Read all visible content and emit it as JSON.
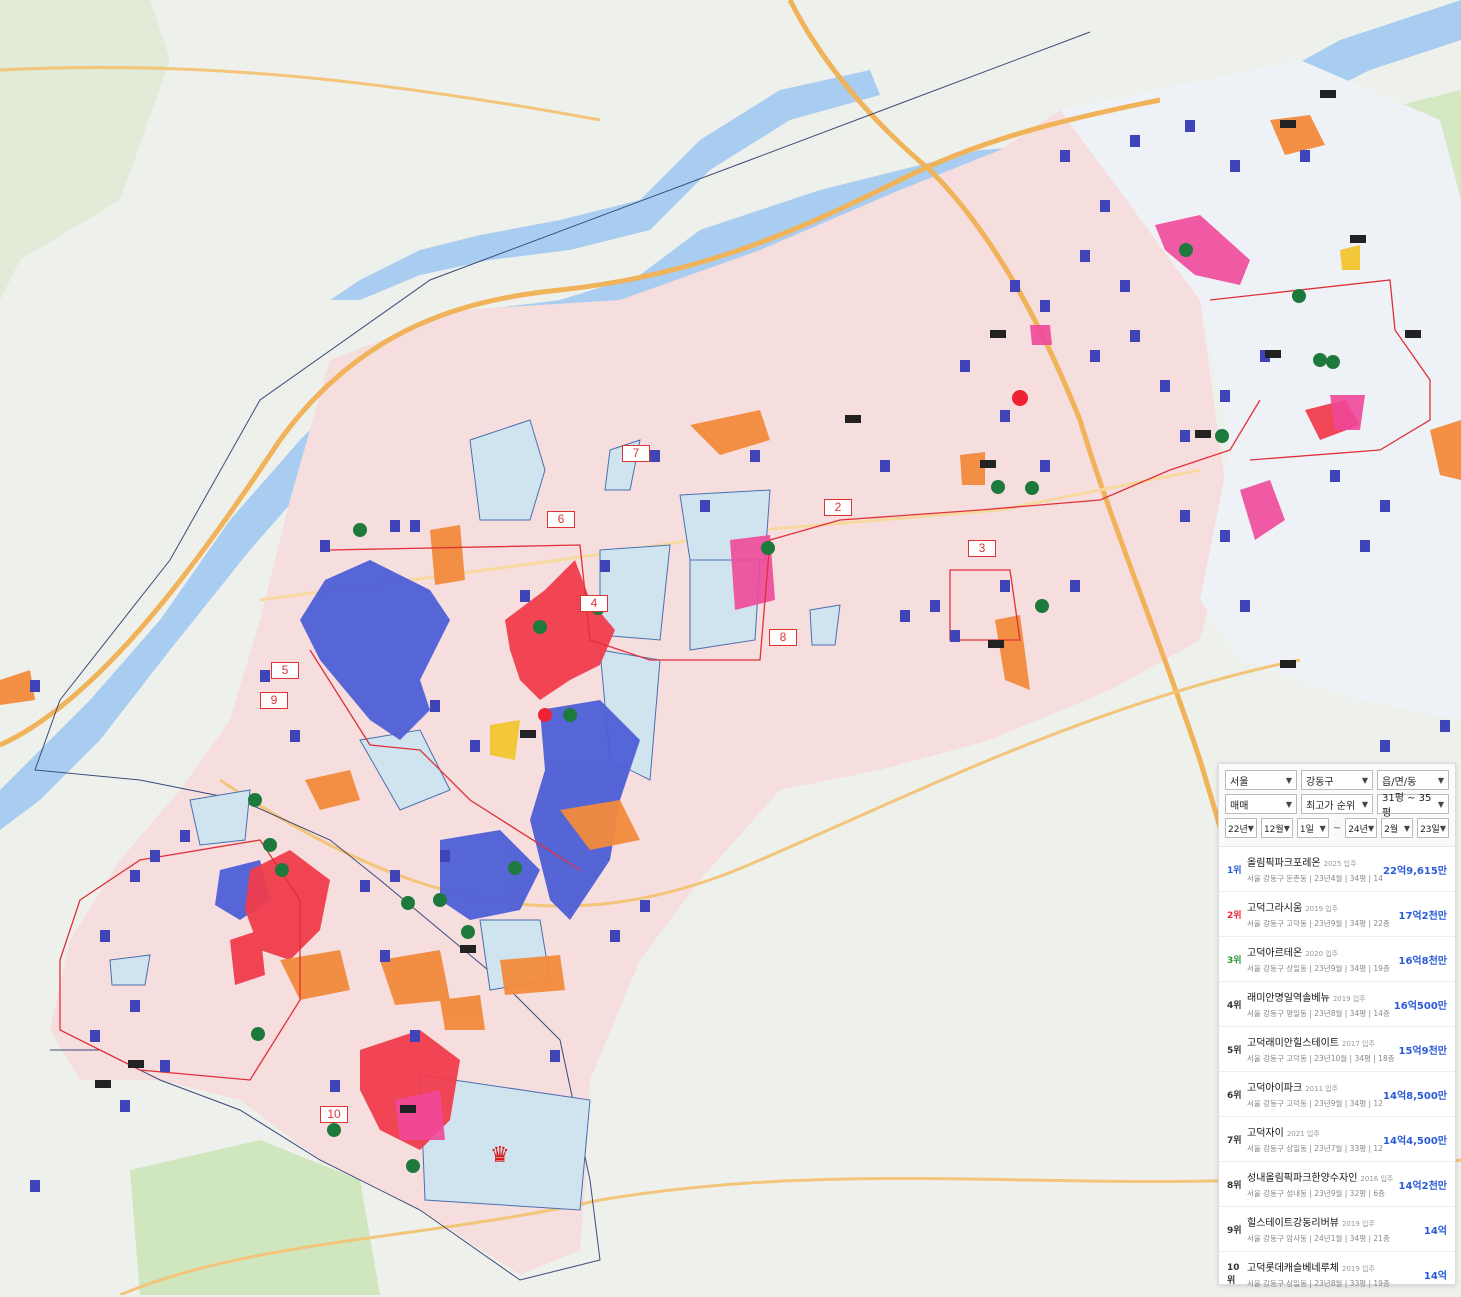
{
  "colors": {
    "water": "#a9cdf0",
    "land": "#eef0ec",
    "district_fill": "#f6dede",
    "park": "#cfe6bf",
    "road": "#f2c57a",
    "highway": "#f0b35a",
    "zone_line": "#e0303a",
    "boundary": "#3c4a7a",
    "blue_area": "#4d5fd6",
    "red_area": "#f03c4c",
    "orange_area": "#f28a3c",
    "pink_area": "#f0489a",
    "lightblue_area": "#cfe4ef",
    "accent": "#2a5bd7"
  },
  "zones": [
    "2",
    "3",
    "4",
    "5",
    "6",
    "7",
    "8",
    "9",
    "10"
  ],
  "filters": {
    "city": "서울",
    "district": "강동구",
    "dong": "읍/면/동",
    "trade": "매매",
    "sort": "최고가 순위",
    "size": "31평 ~ 35평",
    "from_year": "22년",
    "from_month": "12월",
    "from_day": "1일",
    "tilde": "~",
    "to_year": "24년",
    "to_month": "2월",
    "to_day": "23일"
  },
  "ranking": [
    {
      "rank": "1위",
      "name": "올림픽파크포레온",
      "year": "2025 입주",
      "meta": "서울 강동구 둔촌동 | 23년4월 | 34평 | 14층",
      "price": "22억9,615만"
    },
    {
      "rank": "2위",
      "name": "고덕그라시움",
      "year": "2019 입주",
      "meta": "서울 강동구 고덕동 | 23년9월 | 34평 | 22층",
      "price": "17억2천만"
    },
    {
      "rank": "3위",
      "name": "고덕아르테온",
      "year": "2020 입주",
      "meta": "서울 강동구 상일동 | 23년9월 | 34평 | 19층",
      "price": "16억8천만"
    },
    {
      "rank": "4위",
      "name": "래미안명일역솔베뉴",
      "year": "2019 입주",
      "meta": "서울 강동구 명일동 | 23년8월 | 34평 | 14층",
      "price": "16억500만"
    },
    {
      "rank": "5위",
      "name": "고덕래미안힐스테이트",
      "year": "2017 입주",
      "meta": "서울 강동구 고덕동 | 23년10월 | 34평 | 18층",
      "price": "15억9천만"
    },
    {
      "rank": "6위",
      "name": "고덕아이파크",
      "year": "2011 입주",
      "meta": "서울 강동구 고덕동 | 23년9월 | 34평 | 12층",
      "price": "14억8,500만"
    },
    {
      "rank": "7위",
      "name": "고덕자이",
      "year": "2021 입주",
      "meta": "서울 강동구 상일동 | 23년7월 | 33평 | 12층",
      "price": "14억4,500만"
    },
    {
      "rank": "8위",
      "name": "성내올림픽파크한양수자인",
      "year": "2016 입주",
      "meta": "서울 강동구 성내동 | 23년9월 | 32평 | 6층",
      "price": "14억2천만"
    },
    {
      "rank": "9위",
      "name": "힐스테이트강동리버뷰",
      "year": "2019 입주",
      "meta": "서울 강동구 암사동 | 24년1월 | 34평 | 21층",
      "price": "14억"
    },
    {
      "rank": "10위",
      "name": "고덕롯데캐슬베네루체",
      "year": "2019 입주",
      "meta": "서울 강동구 상일동 | 23년8월 | 33평 | 19층",
      "price": "14억"
    }
  ]
}
